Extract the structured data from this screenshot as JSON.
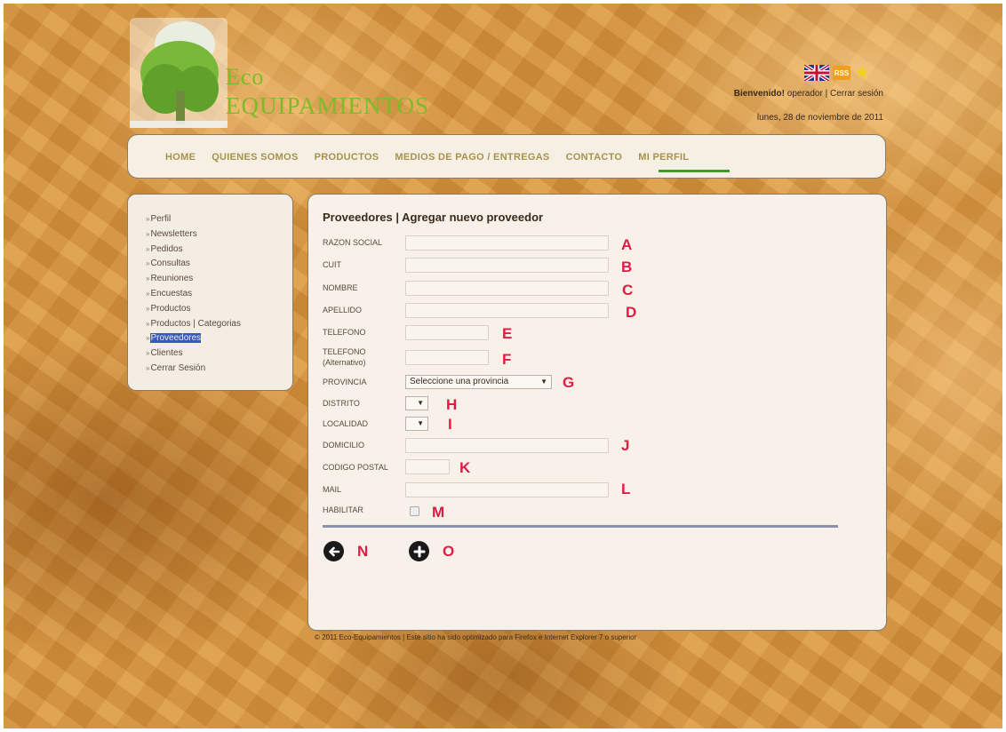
{
  "logo": {
    "line1": "Eco",
    "line2": "EQUIPAMIENTOS"
  },
  "header": {
    "rss_label": "RSS",
    "welcome_prefix": "Bienvenido!",
    "username": "operador",
    "separator": "|",
    "logout": "Cerrar sesión",
    "date": "lunes, 28 de noviembre de 2011"
  },
  "nav": {
    "items": [
      "HOME",
      "QUIENES SOMOS",
      "PRODUCTOS",
      "MEDIOS DE PAGO / ENTREGAS",
      "CONTACTO",
      "MI PERFIL"
    ],
    "active": "MI PERFIL"
  },
  "sidebar": {
    "items": [
      "Perfil",
      "Newsletters",
      "Pedidos",
      "Consultas",
      "Reuniones",
      "Encuestas",
      "Productos",
      "Productos | Categorias",
      "Proveedores",
      "Clientes",
      "Cerrar Sesión"
    ],
    "active": "Proveedores"
  },
  "form": {
    "title": "Proveedores | Agregar nuevo proveedor",
    "fields": {
      "razon_social": {
        "label": "RAZON SOCIAL",
        "marker": "A",
        "value": ""
      },
      "cuit": {
        "label": "CUIT",
        "marker": "B",
        "value": ""
      },
      "nombre": {
        "label": "NOMBRE",
        "marker": "C",
        "value": ""
      },
      "apellido": {
        "label": "APELLIDO",
        "marker": "D",
        "value": ""
      },
      "telefono": {
        "label": "TELEFONO",
        "marker": "E",
        "value": ""
      },
      "telefono_alt": {
        "label_line1": "TELEFONO",
        "label_line2": "(Alternativo)",
        "marker": "F",
        "value": ""
      },
      "provincia": {
        "label": "PROVINCIA",
        "marker": "G",
        "selected": "Seleccione una provincia"
      },
      "distrito": {
        "label": "DISTRITO",
        "marker": "H",
        "selected": ""
      },
      "localidad": {
        "label": "LOCALIDAD",
        "marker": "I",
        "selected": ""
      },
      "domicilio": {
        "label": "DOMICILIO",
        "marker": "J",
        "value": ""
      },
      "codigo_postal": {
        "label": "CODIGO POSTAL",
        "marker": "K",
        "value": ""
      },
      "mail": {
        "label": "MAIL",
        "marker": "L",
        "value": ""
      },
      "habilitar": {
        "label": "HABILITAR",
        "marker": "M",
        "checked": false
      }
    },
    "back_marker": "N",
    "add_marker": "O"
  },
  "footer": {
    "text": "© 2011 Eco-Equipamientos | Este sitio ha sido optimizado para Firefox e Internet Explorer 7 o superior"
  },
  "colors": {
    "accent_green": "#3f9a2c",
    "marker_red": "#e01b44",
    "nav_text": "#a7924d",
    "active_highlight": "#3a5bb5"
  }
}
